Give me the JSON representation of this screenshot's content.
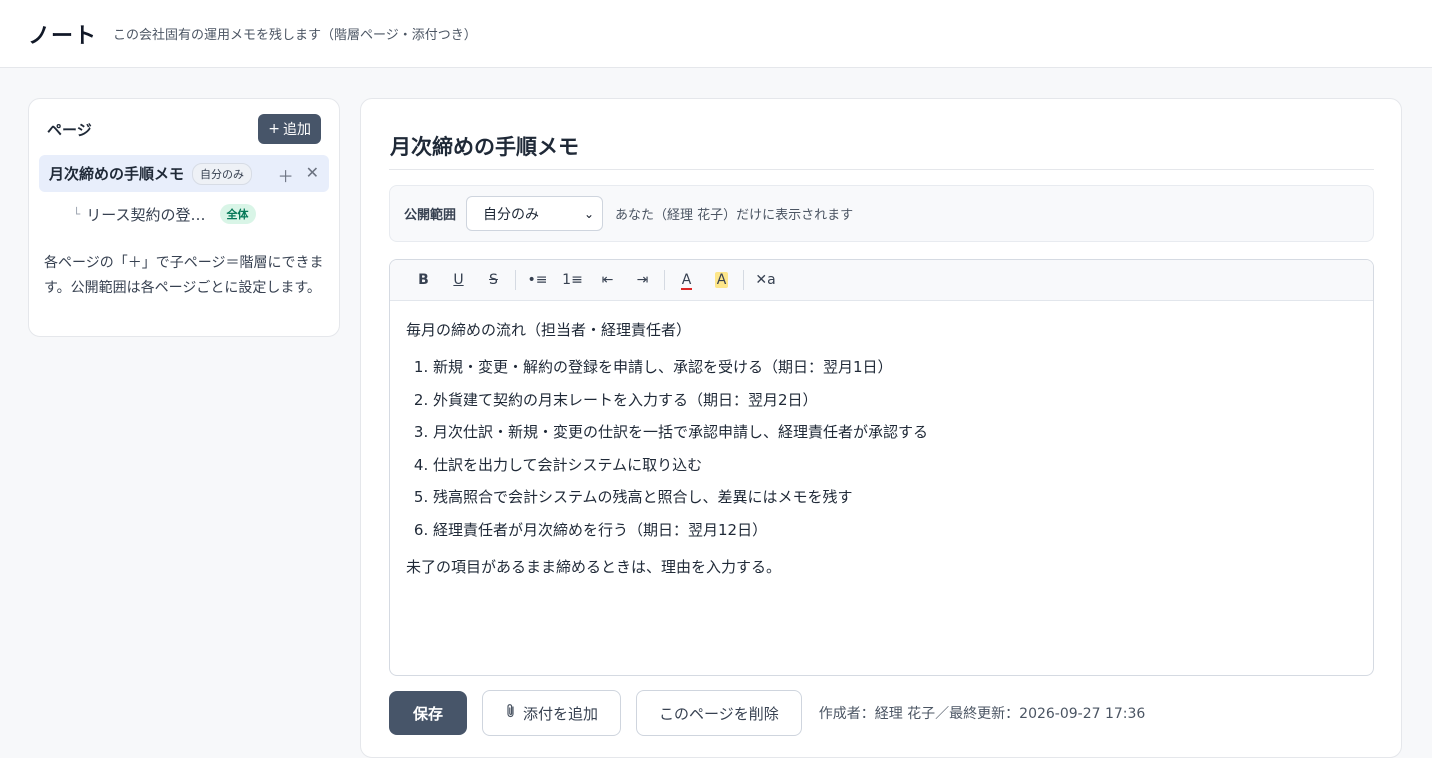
{
  "header": {
    "title": "ノート",
    "subtitle": "この会社固有の運用メモを残します（階層ページ・添付つき）"
  },
  "sidebar": {
    "heading": "ページ",
    "add_label": "追加",
    "add_icon": "+",
    "items": [
      {
        "label": "月次締めの手順メモ",
        "badge": "自分のみ",
        "add_child_icon": "＋",
        "delete_icon": "✕"
      }
    ],
    "children": [
      {
        "branch": "└",
        "label": "リース契約の登…",
        "badge": "全体"
      }
    ],
    "help": "各ページの「＋」で子ページ＝階層にできます。公開範囲は各ページごとに設定します。"
  },
  "main": {
    "title": "月次締めの手順メモ",
    "visibility": {
      "label": "公開範囲",
      "selected": "自分のみ",
      "note": "あなた（経理 花子）だけに表示されます"
    },
    "toolbar": {
      "bold": "B",
      "underline": "U",
      "strike": "S",
      "bullet": "•≡",
      "numbered": "1≡",
      "outdent": "⇤",
      "indent": "⇥",
      "font_color": "A",
      "highlight": "A",
      "clear": "✕a"
    },
    "content": {
      "intro": "毎月の締めの流れ（担当者・経理責任者）",
      "steps": [
        "新規・変更・解約の登録を申請し、承認を受ける（期日：翌月1日）",
        "外貨建て契約の月末レートを入力する（期日：翌月2日）",
        "月次仕訳・新規・変更の仕訳を一括で承認申請し、経理責任者が承認する",
        "仕訳を出力して会計システムに取り込む",
        "残高照合で会計システムの残高と照合し、差異にはメモを残す",
        "経理責任者が月次締めを行う（期日：翌月12日）"
      ],
      "outro": "未了の項目があるまま締めるときは、理由を入力する。"
    },
    "actions": {
      "save": "保存",
      "attach": "添付を追加",
      "attach_icon": "paperclip-icon",
      "delete": "このページを削除"
    },
    "meta": "作成者：経理 花子／最終更新：2026-09-27 17:36"
  },
  "colors": {
    "primary_button": "#475569",
    "active_item_bg": "#e8eefb",
    "badge_all_text": "#047857",
    "badge_all_bg": "#d9f5e7"
  }
}
